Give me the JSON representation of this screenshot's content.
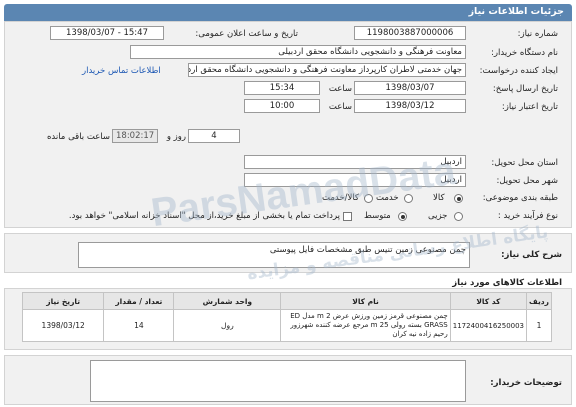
{
  "header": {
    "title": "جزئیات اطلاعات نیاز"
  },
  "form": {
    "need_number_label": "شماره نیاز:",
    "need_number": "1198003887000006",
    "announce_label": "تاریخ و ساعت اعلان عمومی:",
    "announce_value": "1398/03/07 - 15:47",
    "buyer_label": "نام دستگاه خریدار:",
    "buyer_value": "معاونت فرهنگی و دانشجویی دانشگاه محقق اردبیلی",
    "creator_label": "ایجاد کننده درخواست:",
    "creator_value": "جهان خدمتی لاطران کارپرداز معاونت فرهنگی و دانشجویی دانشگاه محقق اردبیلی",
    "contact_link": "اطلاعات تماس خریدار",
    "send_deadline_label": "تاریخ ارسال پاسخ:",
    "send_deadline_date": "1398/03/07",
    "time_label": "ساعت",
    "send_deadline_time": "15:34",
    "validity_label": "تاریخ اعتبار نیاز:",
    "validity_date": "1398/03/12",
    "validity_time": "10:00",
    "days_value": "4",
    "day_and_label": "روز و",
    "remaining_time": "18:02:17",
    "remaining_label": "ساعت باقی مانده",
    "province_label": "استان محل تحویل:",
    "province_value": "اردبیل",
    "city_label": "شهر محل تحویل:",
    "city_value": "اردبیل",
    "category_label": "طبقه بندی موضوعی:",
    "category_options": [
      "کالا",
      "خدمت",
      "کالا/خدمت"
    ],
    "process_label": "نوع فرآیند خرید :",
    "process_options": [
      "جزیی",
      "متوسط"
    ],
    "payment_note": "پرداخت تمام یا بخشی از مبلغ خرید،از محل \"اسناد خزانه اسلامی\" خواهد بود."
  },
  "description": {
    "label": "شرح کلی نیاز:",
    "value": "چمن مصنوعی زمین تنیس طبق مشخصات فایل پیوستی"
  },
  "items": {
    "section_title": "اطلاعات کالاهای مورد نیاز",
    "columns": [
      "ردیف",
      "کد کالا",
      "نام کالا",
      "واحد شمارش",
      "تعداد / مقدار",
      "تاریخ نیاز"
    ],
    "rows": [
      {
        "row": "1",
        "code": "1172400416250003",
        "name": "چمن مصنوعی قرمز زمین ورزش عرض 2 m مدل ED GRASS بسته رولی 25 m مرجع عرضه کننده شهرزور رحیم زاده نیه کران",
        "unit": "رول",
        "qty": "14",
        "date": "1398/03/12"
      }
    ]
  },
  "buyer_notes": {
    "label": "توضیحات خریدار:",
    "value": ""
  },
  "watermark": {
    "line1": "ParsNamadData",
    "line2": "پایگاه اطلاع رسانی مناقصه و مزایده"
  }
}
